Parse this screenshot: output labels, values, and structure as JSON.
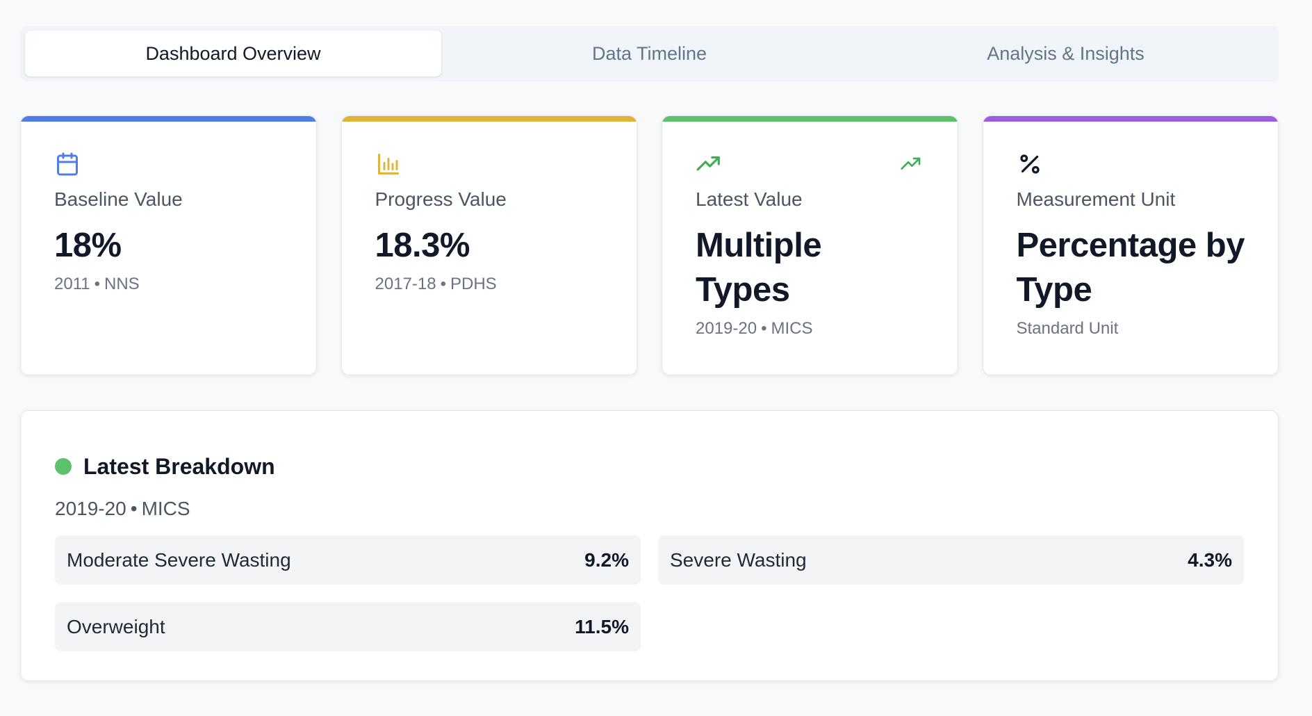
{
  "tabs": [
    {
      "label": "Dashboard Overview",
      "active": true
    },
    {
      "label": "Data Timeline",
      "active": false
    },
    {
      "label": "Analysis & Insights",
      "active": false
    }
  ],
  "cards": {
    "baseline": {
      "icon": "calendar-icon",
      "accent": "#4f7fe6",
      "label": "Baseline Value",
      "value": "18%",
      "year": "2011",
      "source": "NNS"
    },
    "progress": {
      "icon": "bar-chart-icon",
      "accent": "#e0b43a",
      "label": "Progress Value",
      "value": "18.3%",
      "year": "2017-18",
      "source": "PDHS"
    },
    "latest": {
      "icon": "trending-up-icon",
      "accent": "#5cc16a",
      "label": "Latest Value",
      "value": "Multiple Types",
      "year": "2019-20",
      "source": "MICS"
    },
    "unit": {
      "icon": "percent-icon",
      "accent": "#9b5de5",
      "label": "Measurement Unit",
      "value": "Percentage by Type",
      "subtitle": "Standard Unit"
    }
  },
  "breakdown": {
    "title": "Latest Breakdown",
    "year": "2019-20",
    "source": "MICS",
    "items": [
      {
        "name": "Moderate Severe Wasting",
        "value": "9.2%"
      },
      {
        "name": "Severe Wasting",
        "value": "4.3%"
      },
      {
        "name": "Overweight",
        "value": "11.5%"
      }
    ]
  },
  "separator": "•"
}
